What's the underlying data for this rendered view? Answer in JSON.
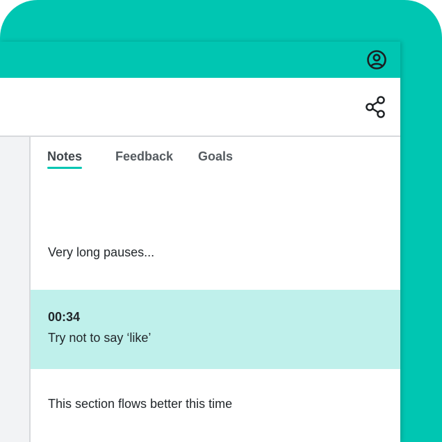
{
  "colors": {
    "accent": "#00c6b2",
    "selected_row": "#bff0eb",
    "sidebar": "#f2f3f5"
  },
  "header": {
    "account_icon": "account-circle-icon",
    "share_icon": "share-icon"
  },
  "notes_panel": {
    "tabs": [
      {
        "label": "Notes",
        "active": true
      },
      {
        "label": "Feedback",
        "active": false
      },
      {
        "label": "Goals",
        "active": false
      }
    ],
    "notes": [
      {
        "time": "",
        "text": "Very long pauses..."
      },
      {
        "time": "00:34",
        "text": "Try not to say ‘like’",
        "selected": true
      },
      {
        "time": "",
        "text": "This section flows better this time"
      }
    ]
  }
}
